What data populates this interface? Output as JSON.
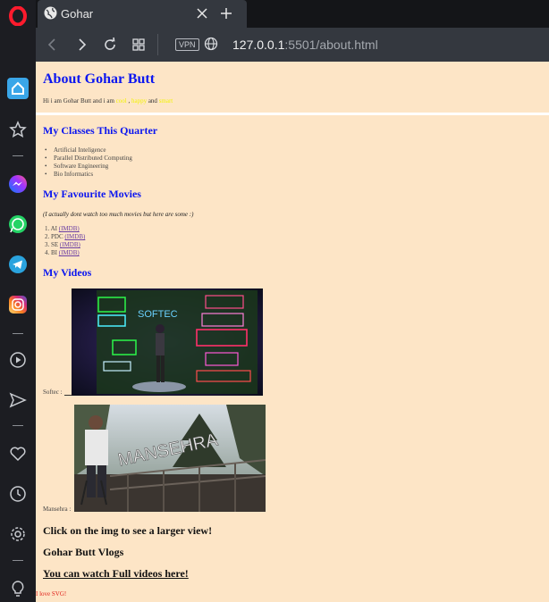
{
  "browser": {
    "tab_title": "Gohar",
    "url_host": "127.0.0.1",
    "url_path": ":5501/about.html",
    "vpn_label": "VPN"
  },
  "sidebar": {
    "icons": [
      "opera-logo-icon",
      "home-icon",
      "star-icon",
      "messenger-icon",
      "whatsapp-icon",
      "telegram-icon",
      "instagram-icon",
      "player-icon",
      "send-icon",
      "heart-icon",
      "history-icon",
      "settings-icon",
      "lightbulb-icon"
    ]
  },
  "page": {
    "heading": "About Gohar Butt",
    "intro_prefix": "Hi i am Gohar Butt and i am",
    "intro_w1": "cool",
    "intro_sep": ",",
    "intro_w2": "happy",
    "intro_and": "and",
    "intro_w3": "smart",
    "classes_heading": "My Classes This Quarter",
    "classes": [
      "Artificial Inteligence",
      "Parallel Distributed Computing",
      "Software Engineering",
      "Bio Informatics"
    ],
    "movies_heading": "My Favourite Movies",
    "movies_note": "(I actually dont watch too much movies but here are some :)",
    "movies": [
      {
        "num": "1.",
        "name": "AI",
        "link": "(IMDB)"
      },
      {
        "num": "2.",
        "name": "PDC",
        "link": "(IMDB)"
      },
      {
        "num": "3.",
        "name": "SE",
        "link": "(IMDB)"
      },
      {
        "num": "4.",
        "name": "BI",
        "link": "(IMDB)"
      }
    ],
    "videos_heading": "My Videos",
    "video1_caption": "Softec :",
    "video2_caption": "Mansehra :",
    "video1_sign": "SOFTEC",
    "video2_sign": "MANSEHRA",
    "click_text": "Click on the img to see a larger view!",
    "vlogs_text": "Gohar Butt Vlogs",
    "full_videos_link": "You can watch Full videos here!",
    "svg_text": "I love SVG!"
  },
  "colors": {
    "page_bg": "#fde5c6",
    "heading_blue": "#0b16f0",
    "highlight_yellow": "#f3f304",
    "svg_red": "#e0201a"
  }
}
